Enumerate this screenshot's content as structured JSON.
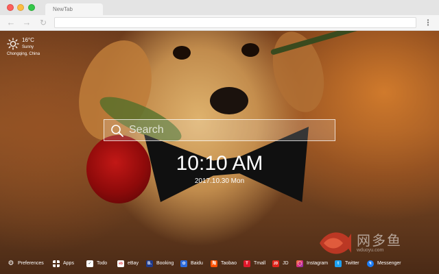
{
  "browser": {
    "tab_title": "NewTab",
    "address": ""
  },
  "weather": {
    "temperature": "16°C",
    "condition": "Sunny",
    "location": "Chongqing,  China",
    "icon": "sun-icon"
  },
  "search": {
    "placeholder": "Search"
  },
  "clock": {
    "time": "10:10 AM",
    "date": "2017.10.30 Mon"
  },
  "watermark": {
    "text": "网多鱼",
    "url": "wduoyu.com"
  },
  "bottom_bar": {
    "items": [
      {
        "label": "Preferences",
        "icon": "gear-icon"
      },
      {
        "label": "Apps",
        "icon": "grid-icon"
      },
      {
        "label": "Todo",
        "icon": "checkbox-icon"
      },
      {
        "label": "eBay",
        "icon": "ebay-icon"
      },
      {
        "label": "Booking",
        "icon": "booking-icon",
        "color": "#1f3a8a"
      },
      {
        "label": "Baidu",
        "icon": "baidu-icon",
        "color": "#2d6bdb"
      },
      {
        "label": "Taobao",
        "icon": "taobao-icon",
        "color": "#ff5000"
      },
      {
        "label": "Tmall",
        "icon": "tmall-icon",
        "color": "#e1182a"
      },
      {
        "label": "JD",
        "icon": "jd-icon",
        "color": "#e1251b"
      },
      {
        "label": "Instagram",
        "icon": "instagram-icon",
        "color": "#d6246e"
      },
      {
        "label": "Twitter",
        "icon": "twitter-icon",
        "color": "#1da1f2"
      },
      {
        "label": "Messenger",
        "icon": "messenger-icon",
        "color": "#1b7cf5"
      }
    ]
  },
  "colors": {
    "accent_white": "#ffffff",
    "background_warm": "#a0622c"
  }
}
